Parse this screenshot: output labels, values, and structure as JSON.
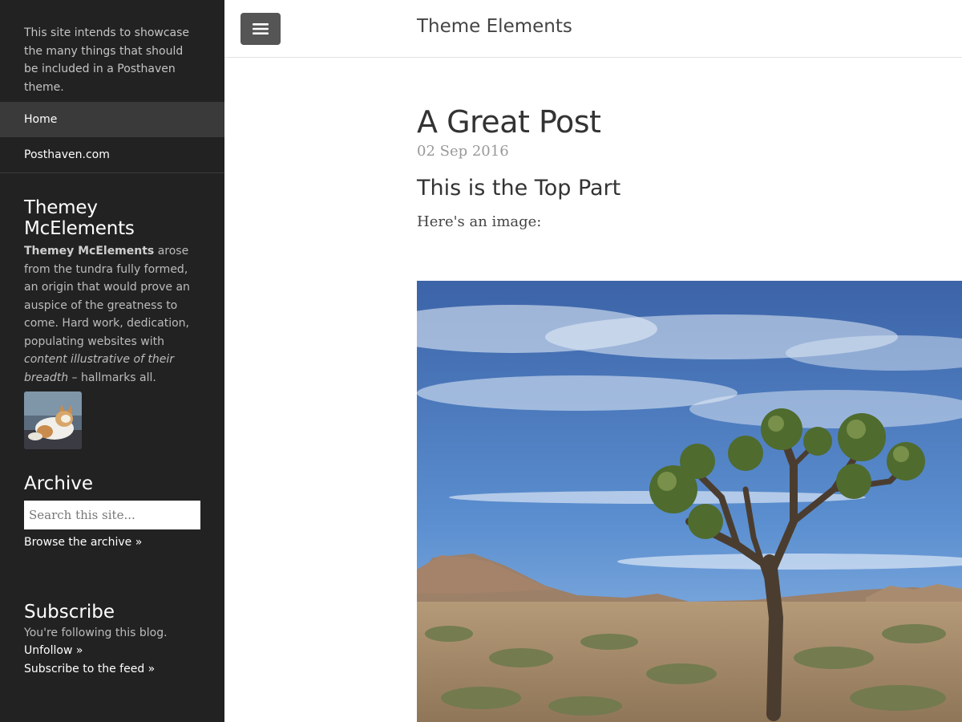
{
  "sidebar": {
    "intro": "This site intends to showcase the many things that should be included in a Posthaven theme.",
    "nav": [
      {
        "label": "Home",
        "active": true
      },
      {
        "label": "Posthaven.com",
        "active": false
      }
    ],
    "bio": {
      "title": "Themey McElements",
      "name_bold": "Themey McElements",
      "text_1": " arose from the tundra fully formed, an origin that would prove an auspice of the greatness to come. Hard work, dedication, populating websites with ",
      "text_italic": "content illustrative of their breadth",
      "text_2": " – hallmarks all."
    },
    "archive": {
      "title": "Archive",
      "search_placeholder": "Search this site...",
      "browse_link": "Browse the archive »"
    },
    "subscribe": {
      "title": "Subscribe",
      "status": "You're following this blog.",
      "unfollow": "Unfollow »",
      "feed": "Subscribe to the feed »"
    }
  },
  "header": {
    "menu_icon": "hamburger-icon",
    "site_title": "Theme Elements"
  },
  "post": {
    "title": "A Great Post",
    "date": "02 Sep 2016",
    "heading": "This is the Top Part",
    "paragraph": "Here's an image:"
  },
  "colors": {
    "sidebar_bg": "#222222",
    "nav_active_bg": "#3a3a3a",
    "menu_button_bg": "#555555"
  }
}
